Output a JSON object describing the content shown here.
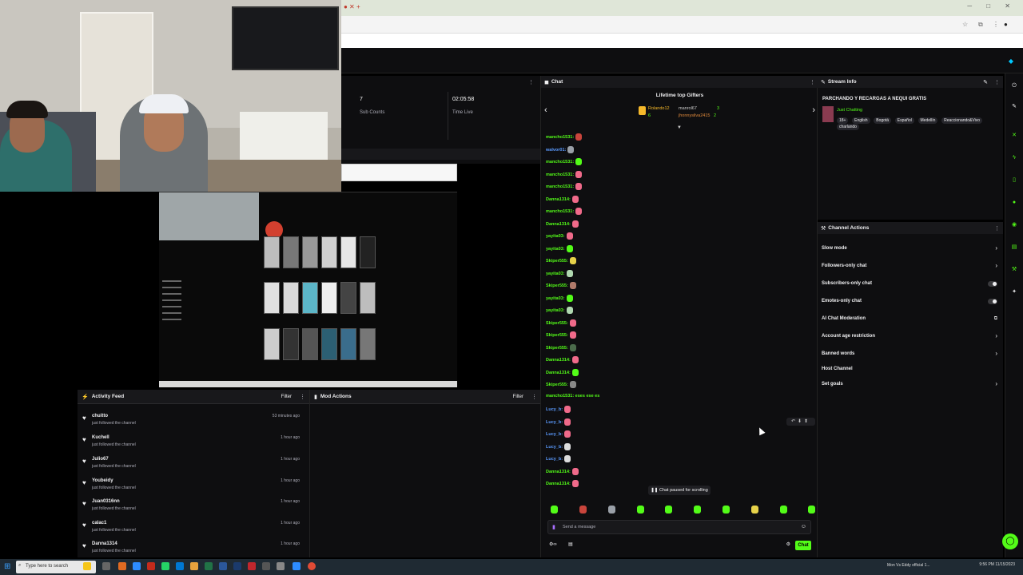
{
  "stats": {
    "sub_value": "7",
    "sub_label": "Sub Counts",
    "time_value": "02:05:58",
    "time_label": "Time Live"
  },
  "activity": {
    "title": "Activity Feed",
    "filter": "Filter",
    "items": [
      {
        "name": "chuitto",
        "sub": "just followed the channel",
        "time": "53 minutes ago"
      },
      {
        "name": "Kuchell",
        "sub": "just followed the channel",
        "time": "1 hour ago"
      },
      {
        "name": "Julio67",
        "sub": "just followed the channel",
        "time": "1 hour ago"
      },
      {
        "name": "Youbeidy",
        "sub": "just followed the channel",
        "time": "1 hour ago"
      },
      {
        "name": "Juan0316nn",
        "sub": "just followed the channel",
        "time": "1 hour ago"
      },
      {
        "name": "calac1",
        "sub": "just followed the channel",
        "time": "1 hour ago"
      },
      {
        "name": "Danna1314",
        "sub": "just followed the channel",
        "time": "1 hour ago"
      }
    ]
  },
  "mod": {
    "title": "Mod Actions",
    "filter": "Filter"
  },
  "chat": {
    "title": "Chat",
    "gifters_title": "Lifetime top Gifters",
    "gifters": [
      {
        "name": "Rolando12",
        "count": "6"
      },
      {
        "name": "manrol67",
        "count": "3"
      },
      {
        "name": "jhonnysilva2415",
        "count": "2"
      }
    ],
    "messages": [
      {
        "user": "mancho1531:",
        "color": "#53fc18",
        "emote": "#c9453c"
      },
      {
        "user": "walvor01:",
        "color": "#5b9bff",
        "emote": "#9aa0a8"
      },
      {
        "user": "mancho1531:",
        "color": "#53fc18",
        "emote": "#53fc18"
      },
      {
        "user": "mancho1531:",
        "color": "#53fc18",
        "emote": "#f06a8a"
      },
      {
        "user": "mancho1531:",
        "color": "#53fc18",
        "emote": "#f06a8a"
      },
      {
        "user": "Danna1314:",
        "color": "#53fc18",
        "emote": "#f06a8a"
      },
      {
        "user": "mancho1531:",
        "color": "#53fc18",
        "emote": "#f06a8a"
      },
      {
        "user": "Danna1314:",
        "color": "#53fc18",
        "emote": "#f06a8a"
      },
      {
        "user": "yayita03:",
        "color": "#53fc18",
        "emote": "#f06a8a"
      },
      {
        "user": "yayita03:",
        "color": "#53fc18",
        "emote": "#53fc18"
      },
      {
        "user": "Skiper555:",
        "color": "#53fc18",
        "emote": "#e6d24a"
      },
      {
        "user": "yayita03:",
        "color": "#53fc18",
        "emote": "#b0d8b0"
      },
      {
        "user": "Skiper555:",
        "color": "#53fc18",
        "emote": "#b07a6a"
      },
      {
        "user": "yayita03:",
        "color": "#53fc18",
        "emote": "#53fc18"
      },
      {
        "user": "yayita03:",
        "color": "#53fc18",
        "emote": "#b0d8b0"
      },
      {
        "user": "Skiper555:",
        "color": "#53fc18",
        "emote": "#f06a8a"
      },
      {
        "user": "Skiper555:",
        "color": "#53fc18",
        "emote": "#f06a8a"
      },
      {
        "user": "Skiper555:",
        "color": "#53fc18",
        "emote": "#4b6b4b"
      },
      {
        "user": "Danna1314:",
        "color": "#53fc18",
        "emote": "#f06a8a"
      },
      {
        "user": "Danna1314:",
        "color": "#53fc18",
        "emote": "#53fc18"
      },
      {
        "user": "Skiper555:",
        "color": "#53fc18",
        "emote": "#888888"
      },
      {
        "user": "mancho1531: eses ese es",
        "color": "#53fc18",
        "emote": ""
      },
      {
        "user": "Lucy_b:",
        "color": "#5b9bff",
        "emote": "#f06a8a"
      },
      {
        "user": "Lucy_b:",
        "color": "#5b9bff",
        "emote": "#f06a8a"
      },
      {
        "user": "Lucy_b:",
        "color": "#5b9bff",
        "emote": "#f06a8a"
      },
      {
        "user": "Lucy_b:",
        "color": "#5b9bff",
        "emote": "#dddddd"
      },
      {
        "user": "Lucy_b:",
        "color": "#5b9bff",
        "emote": "#dddddd"
      },
      {
        "user": "Danna1314:",
        "color": "#53fc18",
        "emote": "#f06a8a"
      },
      {
        "user": "Danna1314:",
        "color": "#53fc18",
        "emote": "#f06a8a"
      }
    ],
    "paused_label": "Chat paused for scrolling",
    "input_placeholder": "Send a message",
    "send_label": "Chat"
  },
  "stream_info": {
    "title": "Stream Info",
    "stream_title": "PARCHANDO Y RECARGAS A NEQUI GRATIS",
    "category": "Just Chatting",
    "tags": [
      "18+",
      "English",
      "Bogotá",
      "Español",
      "Medellín",
      "Reaccionando&Vivo",
      "charlando"
    ]
  },
  "channel_actions": {
    "title": "Channel Actions",
    "items": [
      {
        "label": "Slow mode",
        "control": "chevron"
      },
      {
        "label": "Followers-only chat",
        "control": "chevron"
      },
      {
        "label": "Subscribers-only chat",
        "control": "toggle"
      },
      {
        "label": "Emotes-only chat",
        "control": "toggle"
      },
      {
        "label": "AI Chat Moderation",
        "control": "external"
      },
      {
        "label": "Account age restriction",
        "control": "chevron"
      },
      {
        "label": "Banned words",
        "control": "chevron"
      },
      {
        "label": "Host Channel",
        "control": "none"
      },
      {
        "label": "Set goals",
        "control": "chevron"
      }
    ]
  },
  "taskbar": {
    "search_placeholder": "Type here to search",
    "notif": "Mon Vs Eddy official 1...",
    "time": "9:56 PM",
    "date": "11/15/2023"
  },
  "colors": {
    "accent": "#53fc18",
    "bg": "#0e0e10",
    "panel": "#18181b"
  }
}
